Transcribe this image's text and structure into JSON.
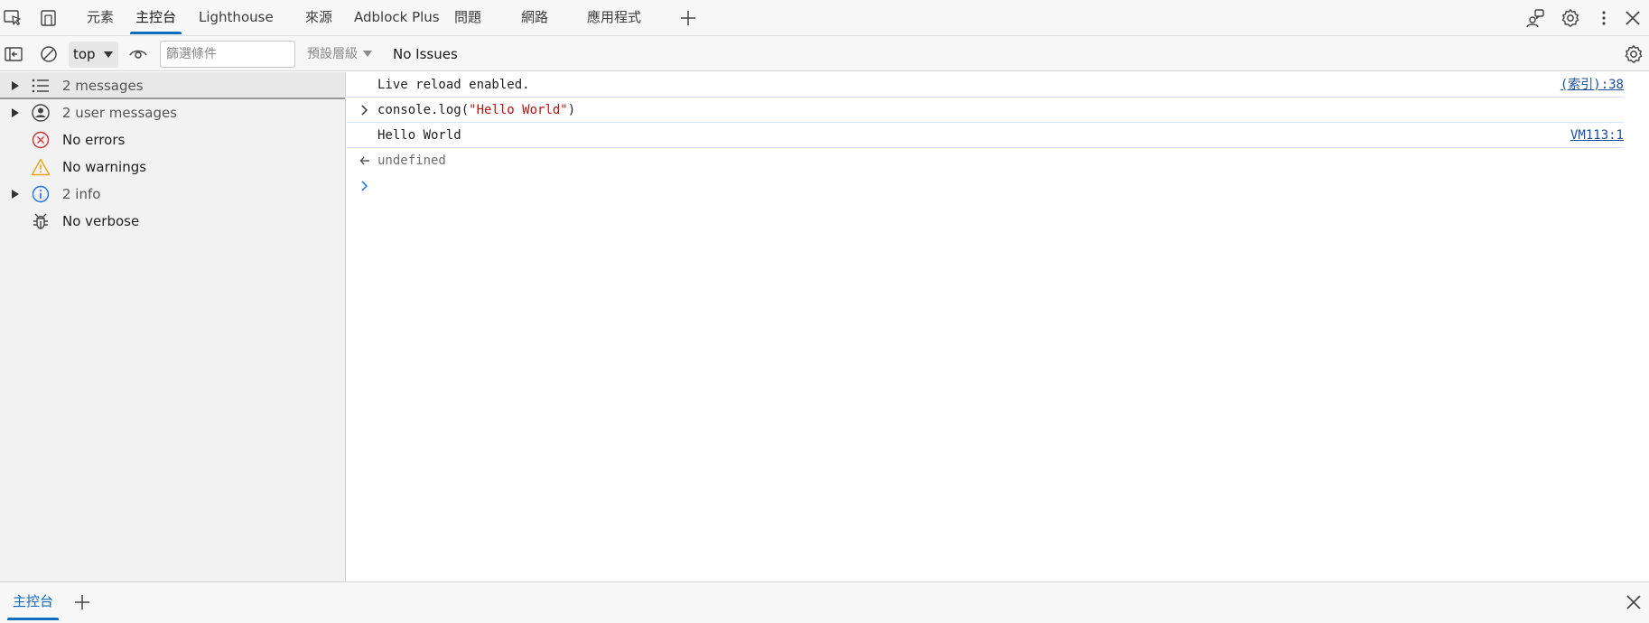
{
  "top_tabs": [
    {
      "label": "元素"
    },
    {
      "label": "主控台"
    },
    {
      "label": "Lighthouse"
    },
    {
      "label": "來源"
    },
    {
      "label": "Adblock Plus"
    },
    {
      "label": "問題"
    },
    {
      "label": "網路"
    },
    {
      "label": "應用程式"
    }
  ],
  "toolbar": {
    "context": "top",
    "filter_placeholder": "篩選條件",
    "levels_label": "預設層級",
    "issues": "No Issues"
  },
  "sidebar": {
    "items": [
      {
        "label": "2 messages",
        "icon": "list-icon"
      },
      {
        "label": "2 user messages",
        "icon": "user-icon"
      },
      {
        "label": "No errors",
        "icon": "error-icon"
      },
      {
        "label": "No warnings",
        "icon": "warning-icon"
      },
      {
        "label": "2 info",
        "icon": "info-icon"
      },
      {
        "label": "No verbose",
        "icon": "bug-icon"
      }
    ]
  },
  "console": {
    "lines": [
      {
        "text": "Live reload enabled.",
        "link": "(索引):38"
      },
      {
        "code_prefix": "console.log(",
        "code_string": "\"Hello World\"",
        "code_suffix": ")"
      },
      {
        "text": "Hello World",
        "link": "VM113:1"
      },
      {
        "text": "undefined"
      }
    ]
  },
  "drawer": {
    "tab": "主控台"
  },
  "colors": {
    "accent": "#0f6cbd",
    "string": "#b31412",
    "error": "#d13438",
    "warning": "#e8a317",
    "info": "#1a73e8",
    "link": "#1a4fa0"
  }
}
